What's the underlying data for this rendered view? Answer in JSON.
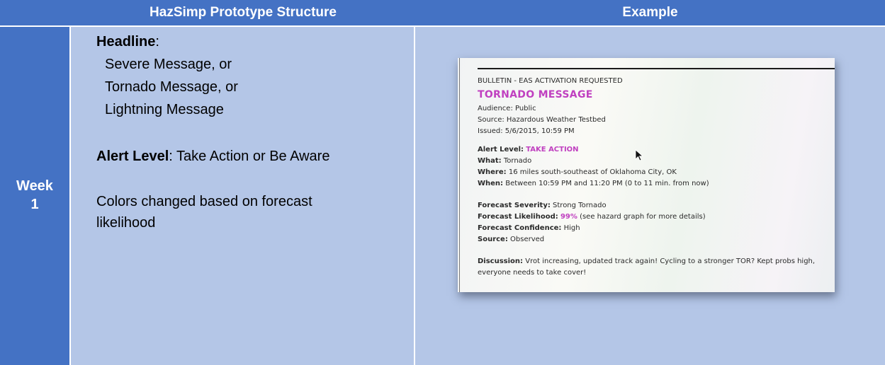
{
  "header": {
    "week_col": "",
    "structure_col": "HazSimp Prototype Structure",
    "example_col": "Example"
  },
  "row": {
    "week_line1": "Week",
    "week_line2": "1",
    "headline_label": "Headline",
    "headline_colon": ":",
    "headline_options": [
      "Severe Message, or",
      "Tornado Message, or",
      "Lightning Message"
    ],
    "alert_label": "Alert Level",
    "alert_text": ": Take Action or Be Aware",
    "colors_line1": "Colors changed based on forecast",
    "colors_line2": "likelihood"
  },
  "example": {
    "bulletin": "BULLETIN - EAS ACTIVATION REQUESTED",
    "title": "TORNADO MESSAGE",
    "audience": "Audience: Public",
    "source_top": "Source: Hazardous Weather Testbed",
    "issued": "Issued: 5/6/2015, 10:59 PM",
    "alert_label": "Alert Level:",
    "alert_value": "TAKE ACTION",
    "what_label": "What:",
    "what_value": "Tornado",
    "where_label": "Where:",
    "where_value": "16 miles south-southeast of Oklahoma City, OK",
    "when_label": "When:",
    "when_value": "Between 10:59 PM and 11:20 PM (0 to 11 min. from now)",
    "severity_label": "Forecast Severity:",
    "severity_value": "Strong Tornado",
    "likelihood_label": "Forecast Likelihood:",
    "likelihood_value": "99%",
    "likelihood_note": "(see hazard graph for more details)",
    "confidence_label": "Forecast Confidence:",
    "confidence_value": "High",
    "source_label": "Source:",
    "source_value": "Observed",
    "discussion_label": "Discussion:",
    "discussion_line1": "Vrot increasing, updated track again! Cycling to a stronger TOR? Kept probs high,",
    "discussion_line2": "everyone needs to take cover!"
  },
  "colors": {
    "header_blue": "#4472c4",
    "cell_light_blue": "#b4c6e7",
    "magenta_accent": "#c040c0"
  }
}
